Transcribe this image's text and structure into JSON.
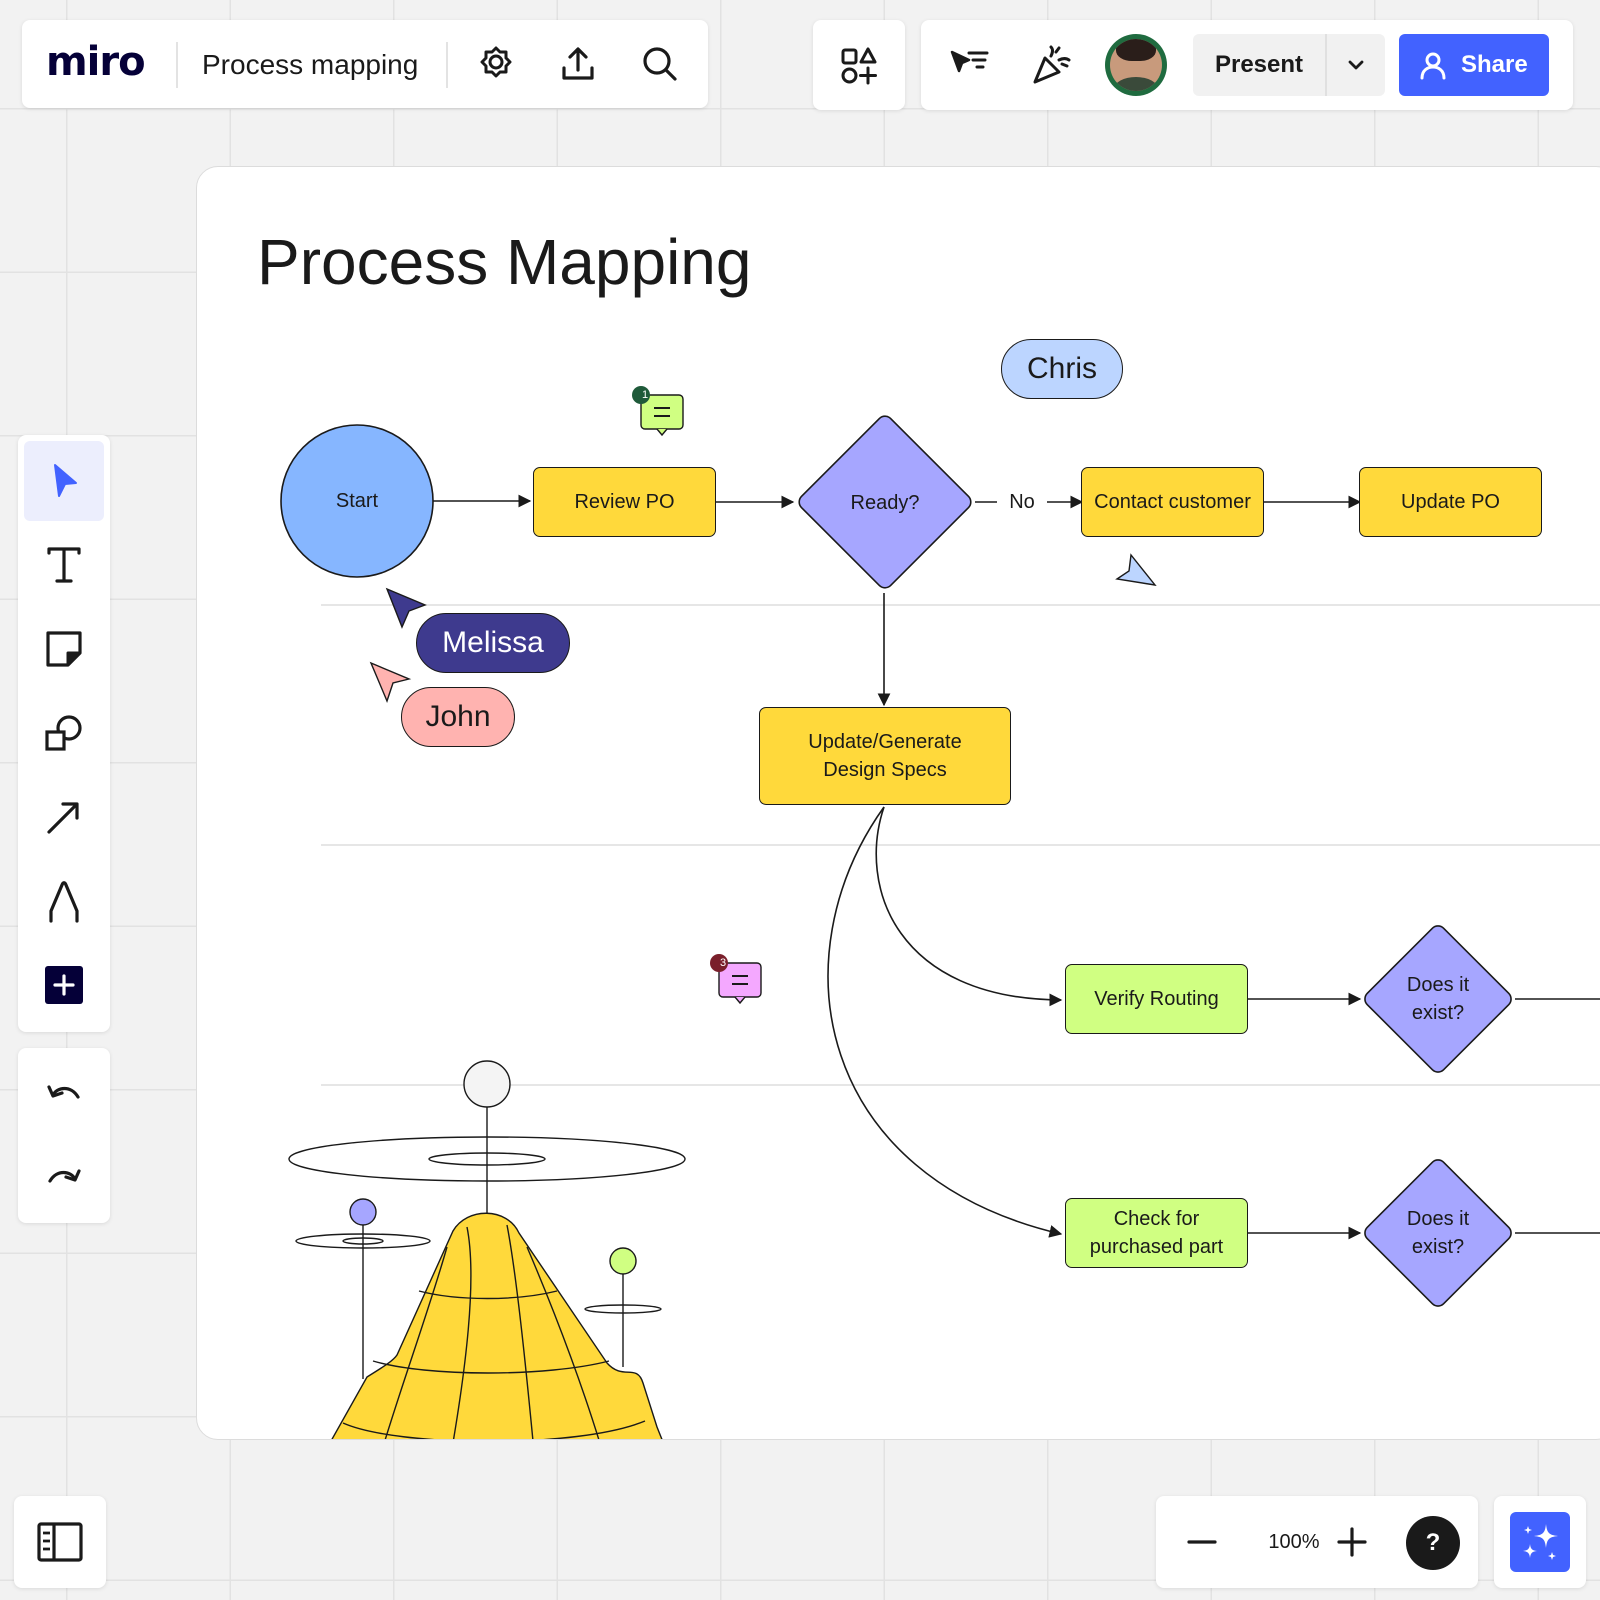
{
  "app": {
    "logo": "miro",
    "board_name": "Process mapping"
  },
  "header": {
    "present_label": "Present",
    "share_label": "Share"
  },
  "frame": {
    "title": "Process Mapping"
  },
  "nodes": {
    "start": "Start",
    "review_po": "Review PO",
    "ready": "Ready?",
    "contact_customer": "Contact customer",
    "update_po": "Update PO",
    "design_specs": "Update/Generate\nDesign Specs",
    "verify_routing": "Verify Routing",
    "check_part": "Check for\npurchased part",
    "exist_1": "Does it\nexist?",
    "exist_2": "Does it\nexist?"
  },
  "edge_labels": {
    "no": "No"
  },
  "collaborators": {
    "chris": "Chris",
    "melissa": "Melissa",
    "john": "John"
  },
  "comments": [
    {
      "count": "1"
    },
    {
      "count": "3"
    }
  ],
  "zoom": {
    "level": "100%",
    "help": "?"
  },
  "colors": {
    "accent": "#4262ff",
    "start_fill": "#86b6ff",
    "process_fill": "#ffd93b",
    "check_fill": "#d0ff82",
    "decision_fill": "#a6a6ff",
    "chris": "#bcd5ff",
    "melissa": "#3e3a8e",
    "john": "#ffb3b0"
  },
  "icons": [
    "settings-icon",
    "upload-icon",
    "search-icon",
    "shapes-plus-icon",
    "cursor-follow-icon",
    "celebrate-icon",
    "chevron-down-icon",
    "user-icon",
    "select-icon",
    "text-icon",
    "sticky-note-icon",
    "shapes-icon",
    "arrow-icon",
    "pen-icon",
    "plus-icon",
    "undo-icon",
    "redo-icon",
    "sidebar-icon",
    "minus-icon",
    "plus-icon",
    "help-icon",
    "sparkle-icon"
  ]
}
